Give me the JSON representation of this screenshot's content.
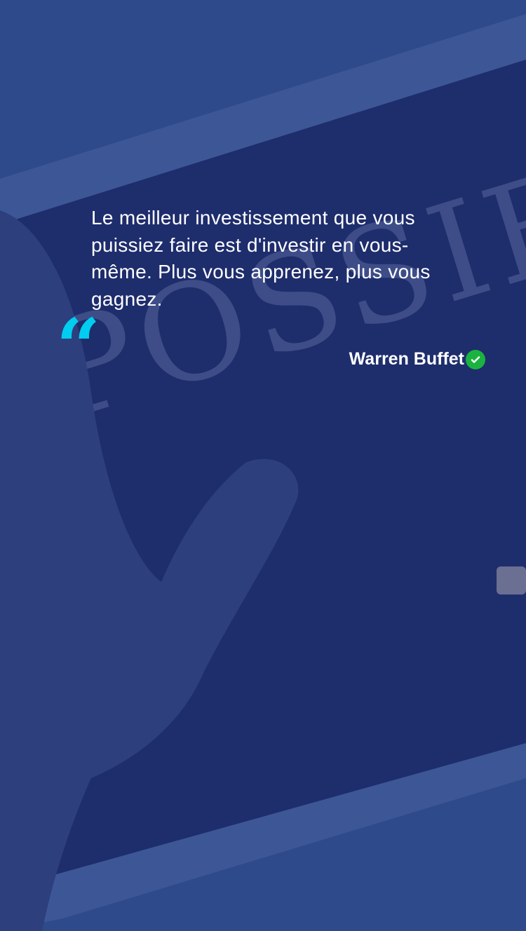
{
  "quote": {
    "text": "Le meilleur investissement que vous puissiez faire est d'investir en vous-même. Plus vous apprenez, plus vous gagnez.",
    "author": "Warren Buffet",
    "quote_icon": "quote-open-icon",
    "verified_icon": "verified-check-icon"
  },
  "colors": {
    "accent": "#00cdf0",
    "verified": "#1bb33f",
    "overlay": "#2e4a8a"
  }
}
